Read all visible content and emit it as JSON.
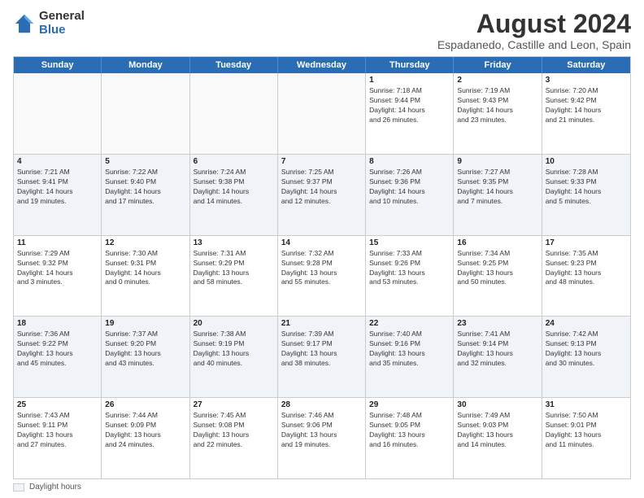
{
  "logo": {
    "general": "General",
    "blue": "Blue"
  },
  "title": "August 2024",
  "subtitle": "Espadanedo, Castille and Leon, Spain",
  "header_days": [
    "Sunday",
    "Monday",
    "Tuesday",
    "Wednesday",
    "Thursday",
    "Friday",
    "Saturday"
  ],
  "legend": {
    "label": "Daylight hours"
  },
  "weeks": [
    {
      "alt": false,
      "days": [
        {
          "num": "",
          "info": ""
        },
        {
          "num": "",
          "info": ""
        },
        {
          "num": "",
          "info": ""
        },
        {
          "num": "",
          "info": ""
        },
        {
          "num": "1",
          "info": "Sunrise: 7:18 AM\nSunset: 9:44 PM\nDaylight: 14 hours\nand 26 minutes."
        },
        {
          "num": "2",
          "info": "Sunrise: 7:19 AM\nSunset: 9:43 PM\nDaylight: 14 hours\nand 23 minutes."
        },
        {
          "num": "3",
          "info": "Sunrise: 7:20 AM\nSunset: 9:42 PM\nDaylight: 14 hours\nand 21 minutes."
        }
      ]
    },
    {
      "alt": true,
      "days": [
        {
          "num": "4",
          "info": "Sunrise: 7:21 AM\nSunset: 9:41 PM\nDaylight: 14 hours\nand 19 minutes."
        },
        {
          "num": "5",
          "info": "Sunrise: 7:22 AM\nSunset: 9:40 PM\nDaylight: 14 hours\nand 17 minutes."
        },
        {
          "num": "6",
          "info": "Sunrise: 7:24 AM\nSunset: 9:38 PM\nDaylight: 14 hours\nand 14 minutes."
        },
        {
          "num": "7",
          "info": "Sunrise: 7:25 AM\nSunset: 9:37 PM\nDaylight: 14 hours\nand 12 minutes."
        },
        {
          "num": "8",
          "info": "Sunrise: 7:26 AM\nSunset: 9:36 PM\nDaylight: 14 hours\nand 10 minutes."
        },
        {
          "num": "9",
          "info": "Sunrise: 7:27 AM\nSunset: 9:35 PM\nDaylight: 14 hours\nand 7 minutes."
        },
        {
          "num": "10",
          "info": "Sunrise: 7:28 AM\nSunset: 9:33 PM\nDaylight: 14 hours\nand 5 minutes."
        }
      ]
    },
    {
      "alt": false,
      "days": [
        {
          "num": "11",
          "info": "Sunrise: 7:29 AM\nSunset: 9:32 PM\nDaylight: 14 hours\nand 3 minutes."
        },
        {
          "num": "12",
          "info": "Sunrise: 7:30 AM\nSunset: 9:31 PM\nDaylight: 14 hours\nand 0 minutes."
        },
        {
          "num": "13",
          "info": "Sunrise: 7:31 AM\nSunset: 9:29 PM\nDaylight: 13 hours\nand 58 minutes."
        },
        {
          "num": "14",
          "info": "Sunrise: 7:32 AM\nSunset: 9:28 PM\nDaylight: 13 hours\nand 55 minutes."
        },
        {
          "num": "15",
          "info": "Sunrise: 7:33 AM\nSunset: 9:26 PM\nDaylight: 13 hours\nand 53 minutes."
        },
        {
          "num": "16",
          "info": "Sunrise: 7:34 AM\nSunset: 9:25 PM\nDaylight: 13 hours\nand 50 minutes."
        },
        {
          "num": "17",
          "info": "Sunrise: 7:35 AM\nSunset: 9:23 PM\nDaylight: 13 hours\nand 48 minutes."
        }
      ]
    },
    {
      "alt": true,
      "days": [
        {
          "num": "18",
          "info": "Sunrise: 7:36 AM\nSunset: 9:22 PM\nDaylight: 13 hours\nand 45 minutes."
        },
        {
          "num": "19",
          "info": "Sunrise: 7:37 AM\nSunset: 9:20 PM\nDaylight: 13 hours\nand 43 minutes."
        },
        {
          "num": "20",
          "info": "Sunrise: 7:38 AM\nSunset: 9:19 PM\nDaylight: 13 hours\nand 40 minutes."
        },
        {
          "num": "21",
          "info": "Sunrise: 7:39 AM\nSunset: 9:17 PM\nDaylight: 13 hours\nand 38 minutes."
        },
        {
          "num": "22",
          "info": "Sunrise: 7:40 AM\nSunset: 9:16 PM\nDaylight: 13 hours\nand 35 minutes."
        },
        {
          "num": "23",
          "info": "Sunrise: 7:41 AM\nSunset: 9:14 PM\nDaylight: 13 hours\nand 32 minutes."
        },
        {
          "num": "24",
          "info": "Sunrise: 7:42 AM\nSunset: 9:13 PM\nDaylight: 13 hours\nand 30 minutes."
        }
      ]
    },
    {
      "alt": false,
      "days": [
        {
          "num": "25",
          "info": "Sunrise: 7:43 AM\nSunset: 9:11 PM\nDaylight: 13 hours\nand 27 minutes."
        },
        {
          "num": "26",
          "info": "Sunrise: 7:44 AM\nSunset: 9:09 PM\nDaylight: 13 hours\nand 24 minutes."
        },
        {
          "num": "27",
          "info": "Sunrise: 7:45 AM\nSunset: 9:08 PM\nDaylight: 13 hours\nand 22 minutes."
        },
        {
          "num": "28",
          "info": "Sunrise: 7:46 AM\nSunset: 9:06 PM\nDaylight: 13 hours\nand 19 minutes."
        },
        {
          "num": "29",
          "info": "Sunrise: 7:48 AM\nSunset: 9:05 PM\nDaylight: 13 hours\nand 16 minutes."
        },
        {
          "num": "30",
          "info": "Sunrise: 7:49 AM\nSunset: 9:03 PM\nDaylight: 13 hours\nand 14 minutes."
        },
        {
          "num": "31",
          "info": "Sunrise: 7:50 AM\nSunset: 9:01 PM\nDaylight: 13 hours\nand 11 minutes."
        }
      ]
    }
  ]
}
